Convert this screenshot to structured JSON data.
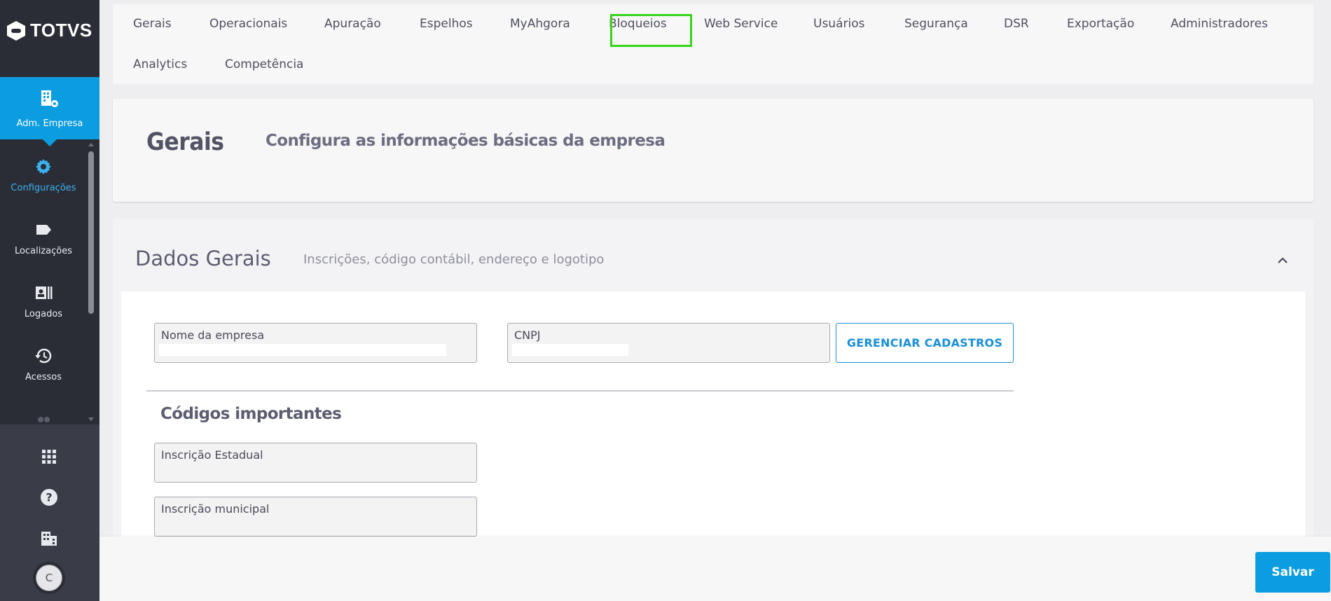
{
  "brand": {
    "logo_text": "TOTVS"
  },
  "sidebar": {
    "active_item": {
      "label": "Adm. Empresa",
      "icon": "company-settings-icon"
    },
    "items": [
      {
        "label": "Configurações",
        "icon": "gear-icon"
      },
      {
        "label": "Localizações",
        "icon": "tag-icon"
      },
      {
        "label": "Logados",
        "icon": "id-card-icon"
      },
      {
        "label": "Acessos",
        "icon": "history-icon"
      }
    ],
    "bottom_icons": [
      "apps-grid-icon",
      "help-icon",
      "building-icon"
    ],
    "avatar_initial": "C"
  },
  "tabs": [
    "Gerais",
    "Operacionais",
    "Apuração",
    "Espelhos",
    "MyAhgora",
    "Bloqueios",
    "Web Service",
    "Usuários",
    "Segurança",
    "DSR",
    "Exportação",
    "Administradores",
    "Analytics",
    "Competência"
  ],
  "highlighted_tab": "MyAhgora",
  "header": {
    "title": "Gerais",
    "subtitle": "Configura as informações básicas da empresa"
  },
  "section": {
    "title": "Dados Gerais",
    "subtitle": "Inscrições, código contábil, endereço e logotipo",
    "fields": {
      "company_name": {
        "label": "Nome da empresa",
        "value": ""
      },
      "cnpj": {
        "label": "CNPJ",
        "value": ""
      },
      "state_registration": {
        "label": "Inscrição Estadual",
        "value": ""
      },
      "municipal_registration": {
        "label": "Inscrição municipal",
        "value": ""
      }
    },
    "manage_button": "GERENCIAR CADASTROS",
    "important_codes_title": "Códigos importantes"
  },
  "footer": {
    "save_label": "Salvar"
  },
  "colors": {
    "sidebar_bg": "#2b2d36",
    "accent": "#0c9ce0",
    "highlight": "#37d41a"
  }
}
